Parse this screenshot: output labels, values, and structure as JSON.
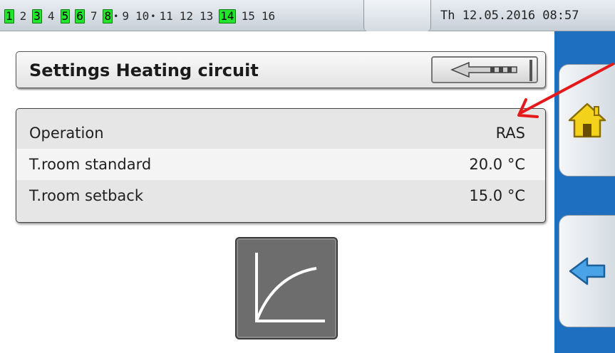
{
  "status_bar": {
    "outputs": [
      {
        "label": "1",
        "active": true
      },
      {
        "label": "2",
        "active": false
      },
      {
        "label": "3",
        "active": true
      },
      {
        "label": "4",
        "active": false
      },
      {
        "label": "5",
        "active": true
      },
      {
        "label": "6",
        "active": true
      },
      {
        "label": "7",
        "active": false
      },
      {
        "label": "8",
        "active": true,
        "dot": true
      },
      {
        "label": "9",
        "active": false
      },
      {
        "label": "10",
        "active": false,
        "dot": true
      },
      {
        "label": "11",
        "active": false
      },
      {
        "label": "12",
        "active": false
      },
      {
        "label": "13",
        "active": false
      },
      {
        "label": "14",
        "active": true
      },
      {
        "label": "15",
        "active": false
      },
      {
        "label": "16",
        "active": false
      }
    ],
    "datetime": "Th 12.05.2016 08:57",
    "active_color": "#22e62c"
  },
  "header": {
    "title": "Settings Heating circuit",
    "back_icon": "back-arrow-icon"
  },
  "settings": {
    "rows": [
      {
        "label": "Operation",
        "value": "RAS"
      },
      {
        "label": "T.room standard",
        "value": "20.0 °C"
      },
      {
        "label": "T.room setback",
        "value": "15.0 °C"
      }
    ]
  },
  "curve_button": {
    "icon": "heating-curve-icon"
  },
  "nav": {
    "home_icon": "home-icon",
    "back_icon": "back-arrow-icon",
    "bar_color": "#1f6fc1"
  },
  "annotation": {
    "icon": "red-arrow-annotation",
    "color": "#e3191c"
  }
}
